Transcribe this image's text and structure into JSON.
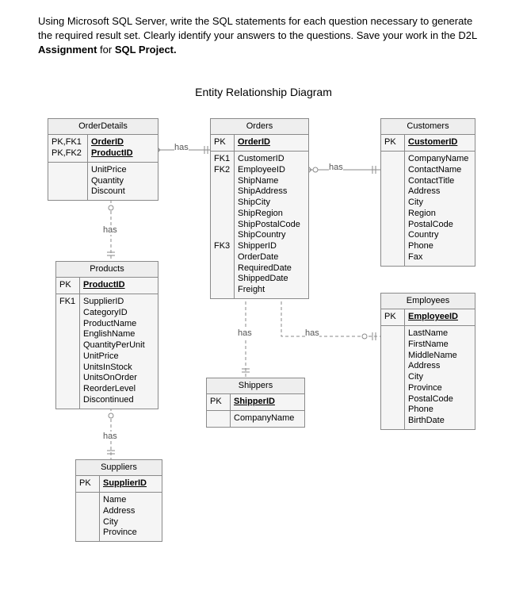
{
  "header": {
    "line1": "Using Microsoft SQL Server, write the SQL statements for each question necessary to generate the required result set. Clearly identify your answers to the questions. Save your work in the D2L ",
    "bold1": "Assignment",
    "mid": " for ",
    "bold2": "SQL Project.",
    "diagram_title": "Entity Relationship Diagram"
  },
  "entities": {
    "orderdetails": {
      "title": "OrderDetails",
      "pk_keys": "PK,FK1\nPK,FK2",
      "pk_attrs": "OrderID\nProductID",
      "attrs": "UnitPrice\nQuantity\nDiscount"
    },
    "orders": {
      "title": "Orders",
      "pk_key": "PK",
      "pk_attr": "OrderID",
      "fk_keys": "FK1\nFK2\n\n\n\n\n\n\nFK3",
      "fk_attrs": "CustomerID\nEmployeeID\nShipName\nShipAddress\nShipCity\nShipRegion\nShipPostalCode\nShipCountry\nShipperID\nOrderDate\nRequiredDate\nShippedDate\nFreight"
    },
    "customers": {
      "title": "Customers",
      "pk_key": "PK",
      "pk_attr": "CustomerID",
      "attrs": "CompanyName\nContactName\nContactTitle\nAddress\nCity\nRegion\nPostalCode\nCountry\nPhone\nFax"
    },
    "products": {
      "title": "Products",
      "pk_key": "PK",
      "pk_attr": "ProductID",
      "fk_key": "FK1",
      "fk_attrs": "SupplierID\nCategoryID\nProductName\nEnglishName\nQuantityPerUnit\nUnitPrice\nUnitsInStock\nUnitsOnOrder\nReorderLevel\nDiscontinued"
    },
    "employees": {
      "title": "Employees",
      "pk_key": "PK",
      "pk_attr": "EmployeeID",
      "attrs": "LastName\nFirstName\nMiddleName\nAddress\nCity\nProvince\nPostalCode\nPhone\nBirthDate"
    },
    "shippers": {
      "title": "Shippers",
      "pk_key": "PK",
      "pk_attr": "ShipperID",
      "attrs": "CompanyName"
    },
    "suppliers": {
      "title": "Suppliers",
      "pk_key": "PK",
      "pk_attr": "SupplierID",
      "attrs": "Name\nAddress\nCity\nProvince"
    }
  },
  "labels": {
    "has1": "has",
    "has2": "has",
    "has3": "has",
    "has4": "has",
    "has5": "has",
    "has6": "has"
  },
  "chart_data": {
    "type": "er-diagram",
    "entities": [
      {
        "name": "OrderDetails",
        "keys": [
          {
            "k": "PK,FK1",
            "a": "OrderID"
          },
          {
            "k": "PK,FK2",
            "a": "ProductID"
          }
        ],
        "attrs": [
          "UnitPrice",
          "Quantity",
          "Discount"
        ]
      },
      {
        "name": "Orders",
        "keys": [
          {
            "k": "PK",
            "a": "OrderID"
          }
        ],
        "fks": [
          {
            "k": "FK1",
            "a": "CustomerID"
          },
          {
            "k": "FK2",
            "a": "EmployeeID"
          },
          {
            "k": "FK3",
            "a": "ShipperID"
          }
        ],
        "attrs": [
          "ShipName",
          "ShipAddress",
          "ShipCity",
          "ShipRegion",
          "ShipPostalCode",
          "ShipCountry",
          "OrderDate",
          "RequiredDate",
          "ShippedDate",
          "Freight"
        ]
      },
      {
        "name": "Customers",
        "keys": [
          {
            "k": "PK",
            "a": "CustomerID"
          }
        ],
        "attrs": [
          "CompanyName",
          "ContactName",
          "ContactTitle",
          "Address",
          "City",
          "Region",
          "PostalCode",
          "Country",
          "Phone",
          "Fax"
        ]
      },
      {
        "name": "Products",
        "keys": [
          {
            "k": "PK",
            "a": "ProductID"
          }
        ],
        "fks": [
          {
            "k": "FK1",
            "a": "SupplierID"
          }
        ],
        "attrs": [
          "CategoryID",
          "ProductName",
          "EnglishName",
          "QuantityPerUnit",
          "UnitPrice",
          "UnitsInStock",
          "UnitsOnOrder",
          "ReorderLevel",
          "Discontinued"
        ]
      },
      {
        "name": "Employees",
        "keys": [
          {
            "k": "PK",
            "a": "EmployeeID"
          }
        ],
        "attrs": [
          "LastName",
          "FirstName",
          "MiddleName",
          "Address",
          "City",
          "Province",
          "PostalCode",
          "Phone",
          "BirthDate"
        ]
      },
      {
        "name": "Shippers",
        "keys": [
          {
            "k": "PK",
            "a": "ShipperID"
          }
        ],
        "attrs": [
          "CompanyName"
        ]
      },
      {
        "name": "Suppliers",
        "keys": [
          {
            "k": "PK",
            "a": "SupplierID"
          }
        ],
        "attrs": [
          "Name",
          "Address",
          "City",
          "Province"
        ]
      }
    ],
    "relationships": [
      {
        "from": "OrderDetails",
        "to": "Orders",
        "label": "has",
        "cardinality": "many-to-one"
      },
      {
        "from": "OrderDetails",
        "to": "Products",
        "label": "has",
        "cardinality": "many-to-one"
      },
      {
        "from": "Orders",
        "to": "Customers",
        "label": "has",
        "cardinality": "many-to-one"
      },
      {
        "from": "Orders",
        "to": "Shippers",
        "label": "has",
        "cardinality": "many-to-one"
      },
      {
        "from": "Orders",
        "to": "Employees",
        "label": "has",
        "cardinality": "many-to-one"
      },
      {
        "from": "Products",
        "to": "Suppliers",
        "label": "has",
        "cardinality": "many-to-one"
      }
    ]
  }
}
